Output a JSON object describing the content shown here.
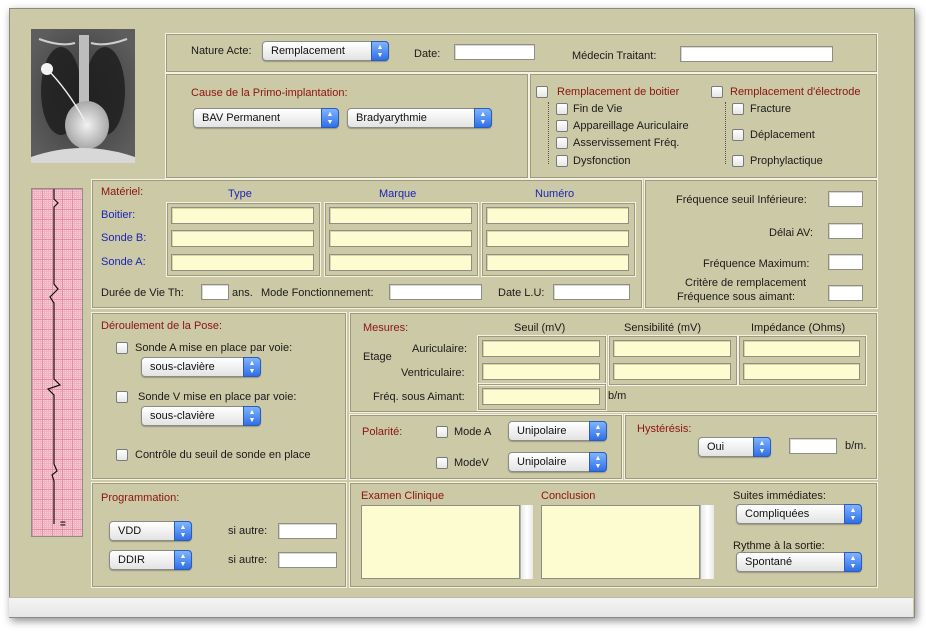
{
  "header": {
    "nature_acte_label": "Nature Acte:",
    "nature_acte_value": "Remplacement",
    "date_label": "Date:",
    "date_value": "",
    "medecin_label": "Médecin Traitant:",
    "medecin_value": ""
  },
  "primo": {
    "title": "Cause de la Primo-implantation:",
    "select1": "BAV Permanent",
    "select2": "Bradyarythmie"
  },
  "replacement": {
    "boitier_title": "Remplacement de boitier",
    "boitier_items": [
      "Fin de Vie",
      "Appareillage Auriculaire",
      "Asservissement Fréq.",
      "Dysfonction"
    ],
    "electrode_title": "Remplacement d'électrode",
    "electrode_items": [
      "Fracture",
      "Déplacement",
      "Prophylactique"
    ]
  },
  "materiel": {
    "title": "Matériel:",
    "col_type": "Type",
    "col_marque": "Marque",
    "col_numero": "Numéro",
    "rows": [
      "Boitier:",
      "Sonde B:",
      "Sonde A:"
    ],
    "duree_label": "Durée de Vie Th:",
    "duree_unit": "ans.",
    "mode_label": "Mode Fonctionnement:",
    "date_lu_label": "Date L.U:"
  },
  "frequences": {
    "seuil_inf": "Fréquence seuil Inférieure:",
    "delai_av": "Délai AV:",
    "freq_max": "Fréquence Maximum:",
    "critere1": "Critère de remplacement",
    "critere2": "Fréquence sous aimant:"
  },
  "pose": {
    "title": "Déroulement de la Pose:",
    "sonde_a": "Sonde A mise en place par voie:",
    "sonde_a_select": "sous-clavière",
    "sonde_v": "Sonde V mise en place par voie:",
    "sonde_v_select": "sous-clavière",
    "controle": "Contrôle du seuil de sonde en place"
  },
  "mesures": {
    "title": "Mesures:",
    "col_seuil": "Seuil (mV)",
    "col_sensibilite": "Sensibilité (mV)",
    "col_impedance": "Impédance (Ohms)",
    "etage": "Etage",
    "auriculaire": "Auriculaire:",
    "ventriculaire": "Ventriculaire:",
    "freq_aimant": "Fréq. sous Aimant:",
    "bpm": "b/m"
  },
  "polarite": {
    "title": "Polarité:",
    "mode_a": "Mode A",
    "mode_a_select": "Unipolaire",
    "mode_v": "ModeV",
    "mode_v_select": "Unipolaire"
  },
  "hysteresis": {
    "title": "Hystérésis:",
    "select": "Oui",
    "unit": "b/m."
  },
  "programmation": {
    "title": "Programmation:",
    "select1": "VDD",
    "select2": "DDIR",
    "si_autre": "si autre:"
  },
  "examen": {
    "title": "Examen Clinique",
    "conclusion": "Conclusion",
    "suites_label": "Suites immédiates:",
    "suites_value": "Compliquées",
    "rythme_label": "Rythme à la sortie:",
    "rythme_value": "Spontané"
  },
  "colors": {
    "panel_bg": "#ccc9a6",
    "field_yellow": "#fdfbd0",
    "label_red": "#8b1410",
    "label_blue": "#1a25b8",
    "popup_accent": "#2f6fe8"
  }
}
